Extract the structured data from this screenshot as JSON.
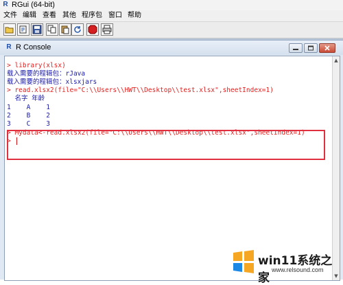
{
  "app": {
    "title": "RGui (64-bit)"
  },
  "menubar": [
    "文件",
    "编辑",
    "查看",
    "其他",
    "程序包",
    "窗口",
    "帮助"
  ],
  "toolbar": {
    "stop_label": "STOP"
  },
  "console": {
    "title": "R Console",
    "lines": [
      {
        "text": "> library(xlsx)",
        "color": "red"
      },
      {
        "text": "载入需要的程辑包：rJava",
        "color": "blue"
      },
      {
        "text": "载入需要的程辑包：xlsxjars",
        "color": "blue"
      },
      {
        "text": "> read.xlsx2(file=\"C:\\\\Users\\\\HWT\\\\Desktop\\\\test.xlsx\",sheetIndex=1)",
        "color": "red"
      },
      {
        "text": "  名字 年龄",
        "color": "blue"
      },
      {
        "text": "1    A    1",
        "color": "blue"
      },
      {
        "text": "2    B    2",
        "color": "blue"
      },
      {
        "text": "3    C    3",
        "color": "blue"
      },
      {
        "text": "> Mydata<-read.xlsx2(file=\"C:\\\\Users\\\\HWT\\\\Desktop\\\\test.xlsx\",sheetIndex=1)",
        "color": "red"
      },
      {
        "text": "> ",
        "color": "red"
      }
    ]
  },
  "watermark": {
    "title": "win11系统之家",
    "url": "www.relsound.com"
  },
  "colors": {
    "prompt": "#e0201e",
    "output": "#1a1aa8",
    "highlight": "#e03040"
  }
}
